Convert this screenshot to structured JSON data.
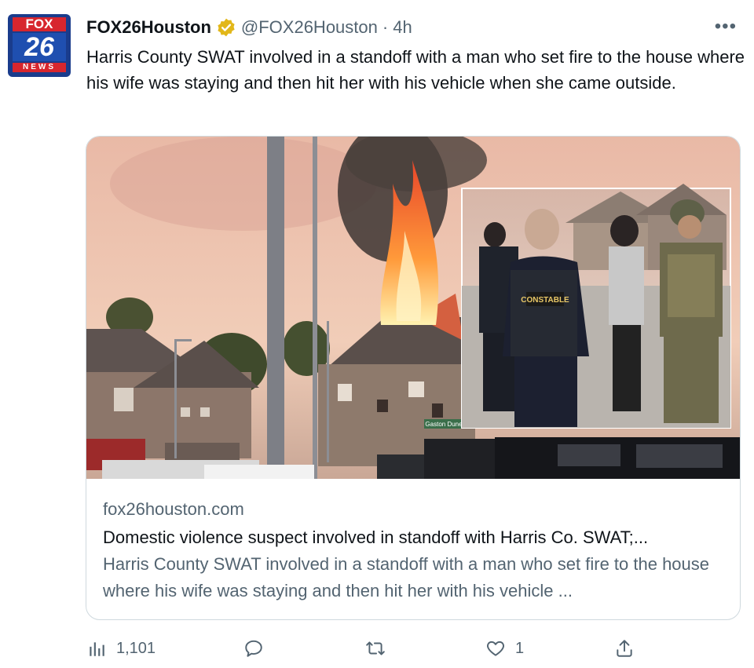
{
  "account": {
    "display_name": "FOX26Houston",
    "handle": "@FOX26Houston",
    "time": "4h",
    "separator": "·",
    "avatar": {
      "top": "FOX",
      "middle": "26",
      "bottom": "NEWS"
    }
  },
  "more_label": "•••",
  "tweet": {
    "text": "Harris County SWAT involved in a standoff with a man who set fire to the house where his wife was staying and then hit her with his vehicle when she came outside."
  },
  "card": {
    "image_texts": {
      "vest": "CONSTABLE",
      "street_sign": "Gaston Dune"
    },
    "domain": "fox26houston.com",
    "title": "Domestic violence suspect involved in standoff with Harris Co. SWAT;...",
    "description": "Harris County SWAT involved in a standoff with a man who set fire to the house where his wife was staying and then hit her with his vehicle ..."
  },
  "actions": {
    "views": {
      "icon": "views-icon",
      "count": "1,101"
    },
    "reply": {
      "icon": "reply-icon",
      "count": ""
    },
    "retweet": {
      "icon": "retweet-icon",
      "count": ""
    },
    "like": {
      "icon": "heart-icon",
      "count": "1"
    },
    "share": {
      "icon": "share-icon",
      "count": ""
    }
  },
  "colors": {
    "verified_gold": "#e2b719",
    "secondary_text": "#536471",
    "border": "#cfd9de"
  }
}
